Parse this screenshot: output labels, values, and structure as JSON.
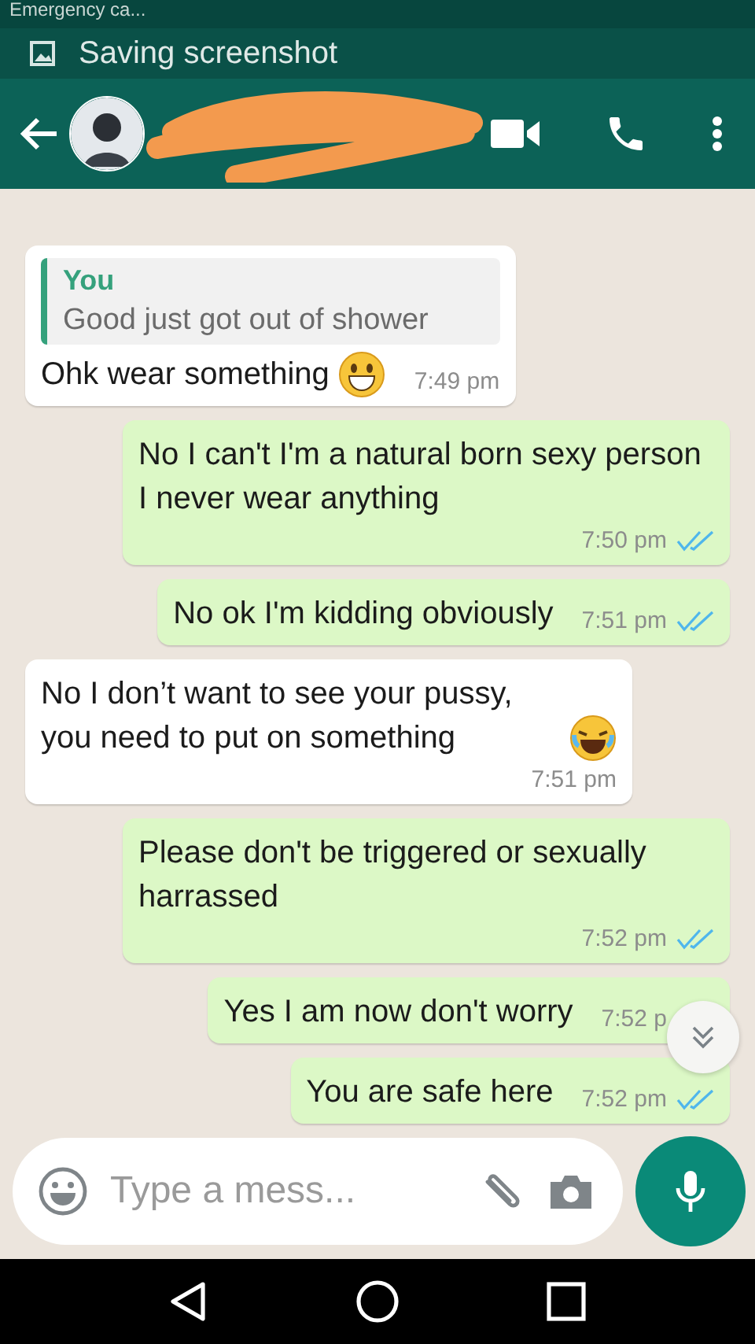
{
  "status_bar": {
    "carrier": "Emergency ca..."
  },
  "notification": {
    "text": "Saving screenshot"
  },
  "header": {
    "redacted": true
  },
  "messages": [
    {
      "kind": "incoming",
      "quote_author": "You",
      "quote_text": "Good just got out of shower",
      "text": "Ohk wear something",
      "emoji": {
        "kind": "grin"
      },
      "time": "7:49 pm"
    },
    {
      "kind": "outgoing",
      "text": "No I can't I'm a natural born sexy person I never wear anything",
      "time": "7:50 pm",
      "read": true
    },
    {
      "kind": "outgoing",
      "text": "No ok I'm kidding obviously",
      "time": "7:51 pm",
      "read": true
    },
    {
      "kind": "incoming",
      "text": "No I don’t want to see your pussy, you need to put on something",
      "emoji": {
        "kind": "laugh"
      },
      "time": "7:51 pm"
    },
    {
      "kind": "outgoing",
      "text": "Please don't be triggered or sexually harrassed",
      "time": "7:52 pm",
      "read": true
    },
    {
      "kind": "outgoing",
      "text": "Yes I am now don't worry",
      "time": "7:52 p"
    },
    {
      "kind": "outgoing",
      "text": "You are safe here",
      "time": "7:52 pm",
      "read": true
    }
  ],
  "composer": {
    "placeholder": "Type a mess..."
  }
}
